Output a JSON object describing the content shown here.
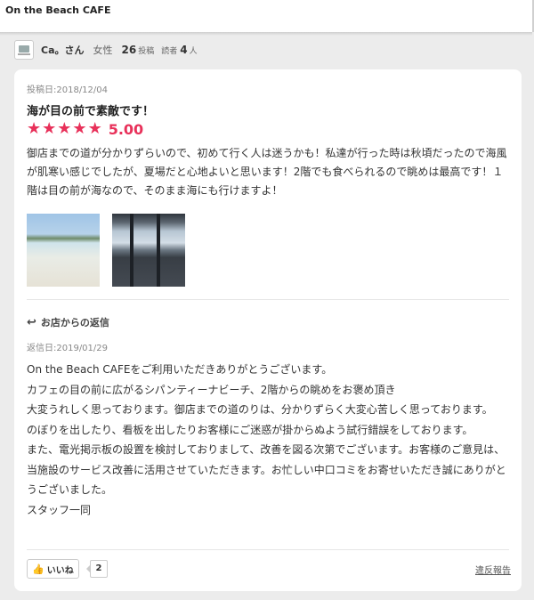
{
  "header": {
    "title": "On the Beach CAFE"
  },
  "user": {
    "name": "Ca。さん",
    "gender": "女性",
    "posts_count": "26",
    "posts_label": "投稿",
    "readers_label": "読者",
    "readers_count": "4",
    "readers_unit": "人"
  },
  "review": {
    "post_date": "投稿日:2018/12/04",
    "title": "海が目の前で素敵です！",
    "rating": 5,
    "rating_text": "5.00",
    "stars": [
      "★",
      "★",
      "★",
      "★",
      "★"
    ],
    "body": "御店までの道が分かりずらいので、初めて行く人は迷うかも！私達が行った時は秋頃だったので海風が肌寒い感じでしたが、夏場だと心地よいと思います！2階でも食べられるので眺めは最高です！１階は目の前が海なので、そのまま海にも行けますよ！",
    "photos": [
      "beach-photo",
      "cafe-interior-photo"
    ]
  },
  "reply": {
    "heading": "お店からの返信",
    "icon": "reply-arrow-icon",
    "date": "返信日:2019/01/29",
    "body": "On the Beach CAFEをご利用いただきありがとうございます。\nカフェの目の前に広がるシパンティーナビーチ、2階からの眺めをお褒め頂き\n大変うれしく思っております。御店までの道のりは、分かりずらく大変心苦しく思っております。\nのぼりを出したり、看板を出したりお客様にご迷惑が掛からぬよう試行錯誤をしております。\nまた、電光掲示板の設置を検討しておりまして、改善を図る次第でございます。お客様のご意見は、当施設のサービス改善に活用させていただきます。お忙しい中口コミをお寄せいただき誠にありがとうございました。\nスタッフ一同"
  },
  "footer": {
    "like_label": "いいね",
    "like_icon": "thumbs-up-icon",
    "like_count": "2",
    "report_label": "違反報告"
  },
  "colors": {
    "accent": "#e8315a",
    "background": "#ececec"
  }
}
